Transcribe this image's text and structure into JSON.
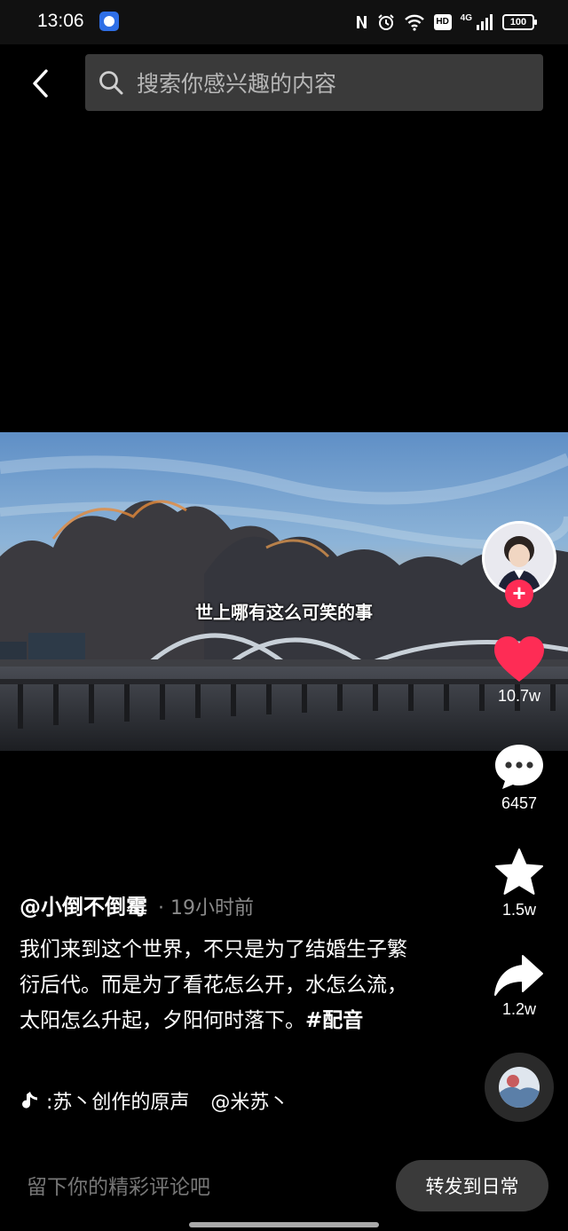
{
  "status_bar": {
    "time": "13:06",
    "net_type": "4G",
    "hd_label": "HD",
    "battery": "100",
    "icons": [
      "nfc-icon",
      "alarm-icon",
      "wifi-icon",
      "hd-badge",
      "signal-icon",
      "battery-icon"
    ]
  },
  "header": {
    "back_icon": "chevron-left-icon",
    "search_placeholder": "搜索你感兴趣的内容"
  },
  "video": {
    "subtitle": "世上哪有这么可笑的事"
  },
  "actions": {
    "follow_label": "+",
    "like_count": "10.7w",
    "comment_count": "6457",
    "favorite_count": "1.5w",
    "share_count": "1.2w"
  },
  "post": {
    "author": "@小倒不倒霉",
    "time": "· 19小时前",
    "caption_text": "我们来到这个世界，不只是为了结婚生子繁衍后代。而是为了看花怎么开，水怎么流，太阳怎么升起，夕阳何时落下。",
    "hashtag": "#配音",
    "music_title": ":苏丶创作的原声",
    "music_mention": "@米苏丶"
  },
  "bottom_bar": {
    "comment_placeholder": "留下你的精彩评论吧",
    "share_daily_label": "转发到日常"
  },
  "colors": {
    "like_red": "#fe2c55",
    "background": "#000000",
    "search_bg": "#3a3a3a"
  }
}
